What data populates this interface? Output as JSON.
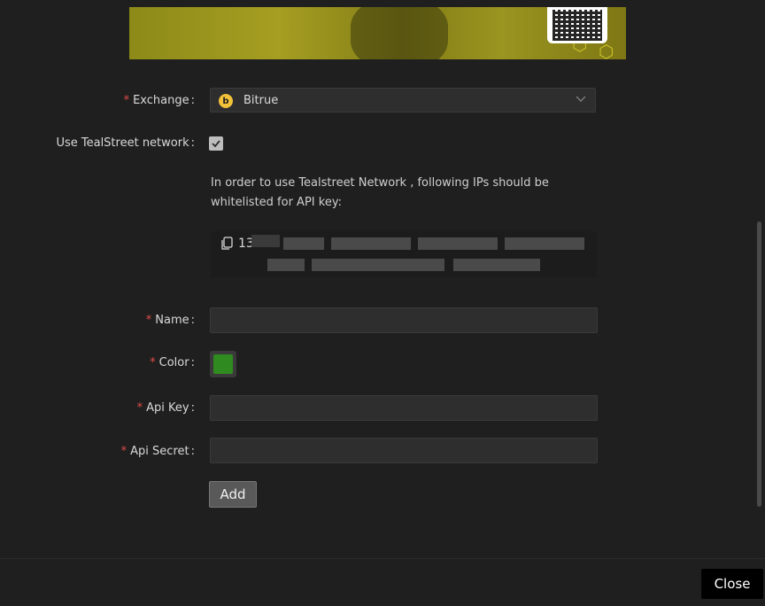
{
  "form": {
    "exchange": {
      "label": "Exchange",
      "value": "Bitrue",
      "logo_letter": "b"
    },
    "tealstreet": {
      "label": "Use TealStreet network",
      "checked": true
    },
    "info_text": "In order to use Tealstreet Network , following IPs should be whitelisted for API key:",
    "ip_prefix": "13",
    "name": {
      "label": "Name"
    },
    "color": {
      "label": "Color",
      "value": "#2f8a1f"
    },
    "api_key": {
      "label": "Api Key"
    },
    "api_secret": {
      "label": "Api Secret"
    },
    "required_mark": "*",
    "colon": ":",
    "add_label": "Add"
  },
  "footer": {
    "close_label": "Close"
  },
  "icons": {
    "exchange_logo": "bitrue-logo-icon",
    "chevron": "chevron-down-icon",
    "copy": "copy-icon",
    "check": "checkmark-icon"
  }
}
